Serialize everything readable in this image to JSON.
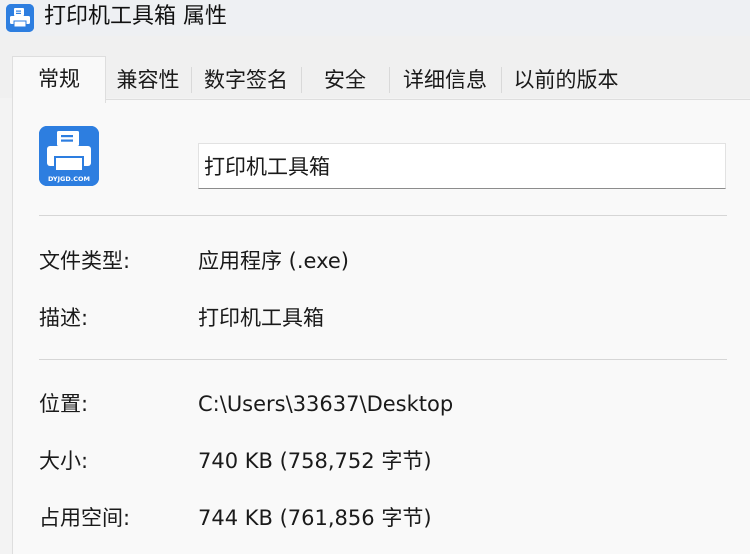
{
  "window": {
    "title": "打印机工具箱 属性",
    "icon": "printer-app-icon"
  },
  "tabs": [
    {
      "label": "常规",
      "active": true
    },
    {
      "label": "兼容性",
      "active": false
    },
    {
      "label": "数字签名",
      "active": false
    },
    {
      "label": "安全",
      "active": false
    },
    {
      "label": "详细信息",
      "active": false
    },
    {
      "label": "以前的版本",
      "active": false
    }
  ],
  "general": {
    "file_icon_text": "DYJGD.COM",
    "name_value": "打印机工具箱",
    "rows": [
      {
        "label": "文件类型:",
        "value": "应用程序 (.exe)"
      },
      {
        "label": "描述:",
        "value": "打印机工具箱"
      },
      {
        "label": "位置:",
        "value": "C:\\Users\\33637\\Desktop"
      },
      {
        "label": "大小:",
        "value": "740 KB (758,752 字节)"
      },
      {
        "label": "占用空间:",
        "value": "744 KB (761,856 字节)"
      }
    ]
  },
  "colors": {
    "icon_blue": "#2d7ee0",
    "window_bg": "#f3f3f3",
    "panel_bg": "#f9f9f9"
  }
}
